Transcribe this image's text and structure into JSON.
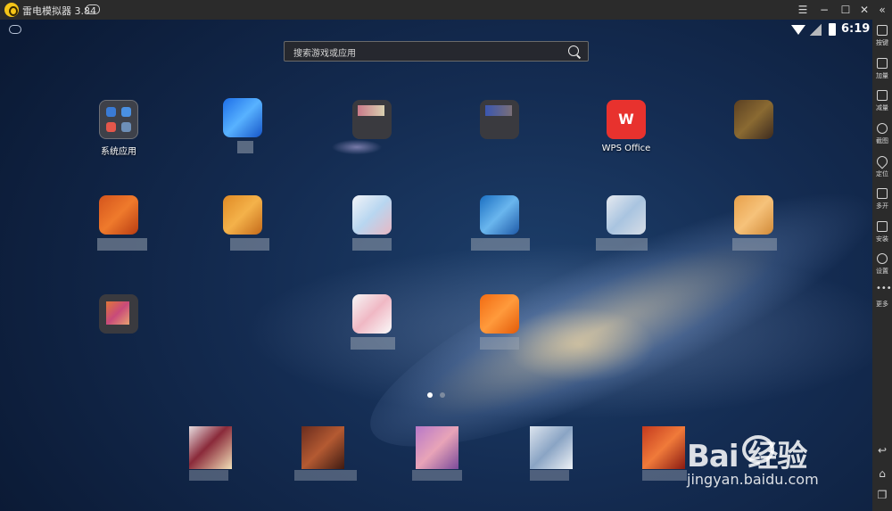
{
  "window": {
    "title": "雷电模拟器 3.84"
  },
  "titlebar": {
    "menu_glyph": "☰",
    "minimize_glyph": "−",
    "maximize_glyph": "☐",
    "close_glyph": "✕",
    "collapse_glyph": "«"
  },
  "status_bar": {
    "time": "6:19"
  },
  "search": {
    "placeholder": "搜索游戏或应用"
  },
  "apps": [
    {
      "name": "folder",
      "label": "系统应用"
    },
    {
      "name": "wps",
      "label": "WPS Office"
    }
  ],
  "sidebar": {
    "items": [
      {
        "label": "按键",
        "icon": "keyboard-icon"
      },
      {
        "label": "加量",
        "icon": "volume-up-icon"
      },
      {
        "label": "减量",
        "icon": "volume-down-icon"
      },
      {
        "label": "截图",
        "icon": "scissors-icon"
      },
      {
        "label": "定位",
        "icon": "location-pin-icon"
      },
      {
        "label": "多开",
        "icon": "multi-instance-icon"
      },
      {
        "label": "安装",
        "icon": "install-apk-icon"
      },
      {
        "label": "设置",
        "icon": "settings-gear-icon"
      },
      {
        "label": "更多",
        "icon": "more-dots-icon"
      }
    ],
    "nav": {
      "back_glyph": "↩",
      "home_glyph": "⌂",
      "recents_glyph": "❐"
    }
  },
  "watermark": {
    "brand": "Bai  经验",
    "url": "jingyan.baidu.com"
  },
  "colors": {
    "wps_red": "#e8322e",
    "titlebar_bg": "#2b2b2b",
    "sidebar_bg": "#2b2b2b",
    "logo_yellow": "#f5c518"
  }
}
